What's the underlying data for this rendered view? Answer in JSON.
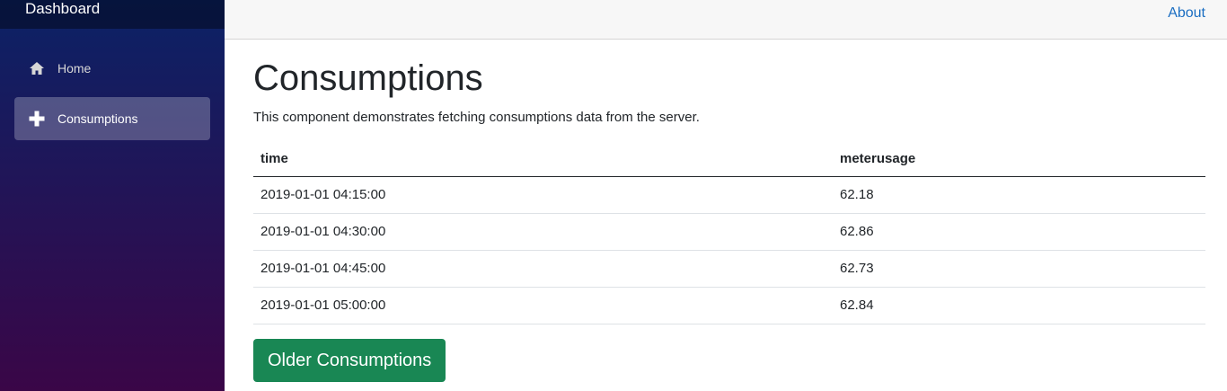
{
  "app": {
    "brand": "Dashboard"
  },
  "sidebar": {
    "items": [
      {
        "label": "Home",
        "icon": "home-icon",
        "active": false
      },
      {
        "label": "Consumptions",
        "icon": "plus-icon",
        "active": true
      }
    ]
  },
  "topbar": {
    "about_label": "About"
  },
  "main": {
    "title": "Consumptions",
    "description": "This component demonstrates fetching consumptions data from the server.",
    "table": {
      "headers": [
        "time",
        "meterusage"
      ],
      "rows": [
        [
          "2019-01-01 04:15:00",
          "62.18"
        ],
        [
          "2019-01-01 04:30:00",
          "62.86"
        ],
        [
          "2019-01-01 04:45:00",
          "62.73"
        ],
        [
          "2019-01-01 05:00:00",
          "62.84"
        ]
      ]
    },
    "older_button_label": "Older Consumptions"
  },
  "colors": {
    "sidebar_top": "#0b2266",
    "sidebar_bottom": "#3a0647",
    "link": "#1b6ec2",
    "button": "#198754"
  }
}
